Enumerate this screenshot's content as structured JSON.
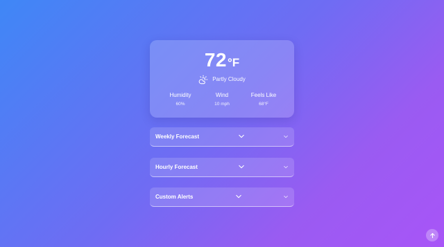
{
  "current": {
    "temperature": "72",
    "unit": "°F",
    "condition": "Partly Cloudy",
    "condition_icon": "partly-cloudy-icon"
  },
  "stats": [
    {
      "label": "Humidity",
      "value": "60%"
    },
    {
      "label": "Wind",
      "value": "10 mph"
    },
    {
      "label": "Feels Like",
      "value": "68°F"
    }
  ],
  "sections": [
    {
      "title": "Weekly Forecast"
    },
    {
      "title": "Hourly Forecast"
    },
    {
      "title": "Custom Alerts"
    }
  ],
  "controls": {
    "scroll_top_icon": "arrow-up-icon"
  },
  "colors": {
    "gradient_start": "#3f87f6",
    "gradient_end": "#a855f7"
  }
}
